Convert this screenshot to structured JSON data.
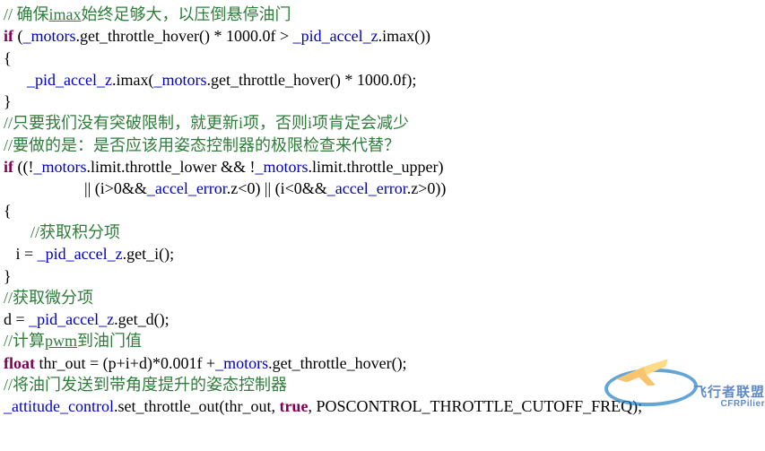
{
  "lines": {
    "c1a": "// 确保",
    "c1b": "imax",
    "c1c": "始终足够大，以压倒悬停油门",
    "k_if": "if",
    "l2_a": " (",
    "l2_m1": "_motors",
    "l2_b": ".get_throttle_hover() * 1000.0f > ",
    "l2_m2": "_pid_accel_z",
    "l2_c": ".imax())",
    "brace_open": "{",
    "l4_a": "_pid_accel_z",
    "l4_b": ".imax(",
    "l4_c": "_motors",
    "l4_d": ".get_throttle_hover() * 1000.0f);",
    "brace_close": "}",
    "c2": "//只要我们没有突破限制，就更新i项，否则i项肯定会减少",
    "c3": "//要做的是：是否应该用姿态控制器的极限检查来代替？",
    "l8_a": " ((!",
    "l8_m1": "_motors",
    "l8_b": ".limit.throttle_lower && !",
    "l8_m2": "_motors",
    "l8_c": ".limit.throttle_upper)",
    "l9_a": "|| (i>0&&",
    "l9_m1": "_accel_error",
    "l9_b": ".z<0) || (i<0&&",
    "l9_m2": "_accel_error",
    "l9_c": ".z>0))",
    "c4": "//获取积分项",
    "l12_a": "i = ",
    "l12_m": "_pid_accel_z",
    "l12_b": ".get_i();",
    "c5": "//获取微分项",
    "l15_a": "d = ",
    "l15_m": "_pid_accel_z",
    "l15_b": ".get_d();",
    "c6a": "//计算",
    "c6b": "pwm",
    "c6c": "到油门值",
    "k_float": "float",
    "l17_a": " thr_out = (p+i+d)*0.001f +",
    "l17_m": "_motors",
    "l17_b": ".get_throttle_hover();",
    "c7": "//将油门发送到带角度提升的姿态控制器",
    "l19_m": "_attitude_control",
    "l19_a": ".set_throttle_out(thr_out, ",
    "k_true": "true",
    "l19_b": ", POSCONTROL_THROTTLE_CUTOFF_FREQ);"
  },
  "watermark": {
    "cn": "飞行者联盟",
    "en": "CFRPilier"
  }
}
